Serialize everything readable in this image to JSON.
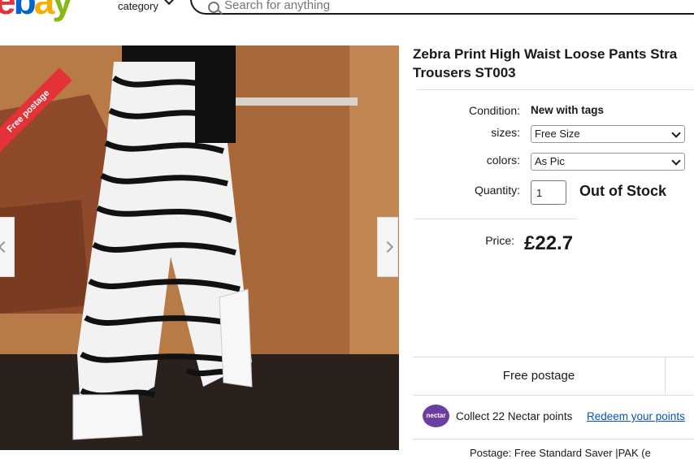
{
  "header": {
    "logo_letters": [
      "e",
      "b",
      "a",
      "y"
    ],
    "category_label": "category",
    "search_placeholder": "Search for anything"
  },
  "gallery": {
    "ribbon_text": "Free postage"
  },
  "product": {
    "title_line1": "Zebra Print High Waist Loose Pants Stra",
    "title_line2": "Trousers ST003",
    "condition_label": "Condition:",
    "condition_value": "New with tags",
    "sizes_label": "sizes:",
    "sizes_value": "Free Size",
    "colors_label": "colors:",
    "colors_value": "As Pic",
    "quantity_label": "Quantity:",
    "quantity_value": "1",
    "stock_status": "Out of Stock",
    "price_label": "Price:",
    "price_value": "£22.7"
  },
  "shipping": {
    "free_postage": "Free postage"
  },
  "nectar": {
    "badge": "nectar",
    "text": "Collect 22 Nectar points",
    "link": "Redeem your points"
  },
  "postage_partial": "Postage:   Free Standard Saver |PAK (e"
}
